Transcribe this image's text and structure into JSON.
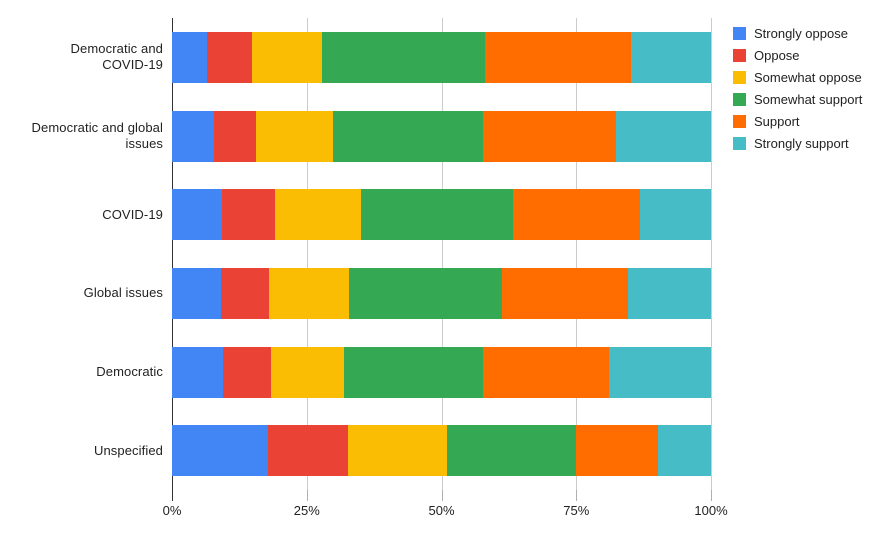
{
  "chart_data": {
    "type": "bar",
    "orientation": "horizontal",
    "stacked": true,
    "normalized": true,
    "title": "",
    "subtitle": "",
    "xlabel": "",
    "ylabel": "",
    "xlim": [
      0,
      100
    ],
    "xticks": [
      0,
      25,
      50,
      75,
      100
    ],
    "xtick_labels": [
      "0%",
      "25%",
      "50%",
      "75%",
      "100%"
    ],
    "grid": true,
    "grid_axis": "x",
    "legend_position": "right",
    "categories": [
      "Democratic and COVID-19",
      "Democratic and global issues",
      "COVID-19",
      "Global issues",
      "Democratic",
      "Unspecified"
    ],
    "category_lines": [
      [
        "Democratic and",
        "COVID-19"
      ],
      [
        "Democratic and global",
        "issues"
      ],
      [
        "COVID-19"
      ],
      [
        "Global issues"
      ],
      [
        "Democratic"
      ],
      [
        "Unspecified"
      ]
    ],
    "series": [
      {
        "name": "Strongly oppose",
        "color": "#4285F4",
        "values": [
          6.5,
          7.8,
          9.3,
          9.1,
          9.5,
          17.8
        ]
      },
      {
        "name": "Oppose",
        "color": "#EA4335",
        "values": [
          8.3,
          7.8,
          9.8,
          8.9,
          8.9,
          14.9
        ]
      },
      {
        "name": "Somewhat oppose",
        "color": "#FBBC04",
        "values": [
          13.0,
          14.3,
          16.0,
          14.8,
          13.5,
          18.3
        ]
      },
      {
        "name": "Somewhat support",
        "color": "#34A853",
        "values": [
          30.2,
          27.8,
          28.2,
          28.4,
          25.8,
          24.0
        ]
      },
      {
        "name": "Support",
        "color": "#FF6D01",
        "values": [
          27.1,
          24.7,
          23.5,
          23.4,
          23.3,
          15.2
        ]
      },
      {
        "name": "Strongly support",
        "color": "#46BDC6",
        "values": [
          14.9,
          17.6,
          13.2,
          15.4,
          19.0,
          9.8
        ]
      }
    ]
  },
  "legend": {
    "items": [
      {
        "label": "Strongly oppose",
        "color": "#4285F4"
      },
      {
        "label": "Oppose",
        "color": "#EA4335"
      },
      {
        "label": "Somewhat oppose",
        "color": "#FBBC04"
      },
      {
        "label": "Somewhat support",
        "color": "#34A853"
      },
      {
        "label": "Support",
        "color": "#FF6D01"
      },
      {
        "label": "Strongly support",
        "color": "#46BDC6"
      }
    ]
  }
}
